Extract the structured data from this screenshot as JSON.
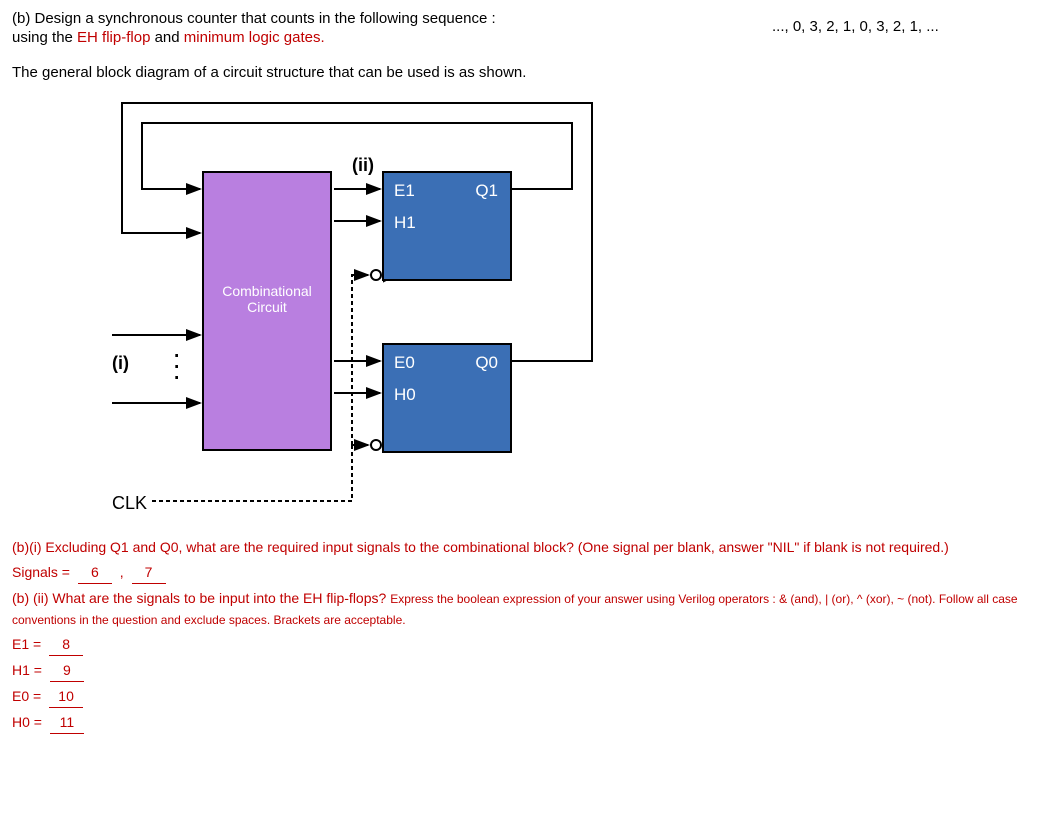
{
  "header": {
    "part": "(b)",
    "q_text_1": " Design a synchronous counter that counts in the following sequence :",
    "q_text_2": "using the ",
    "eh": "EH flip-flop",
    "and_": " and ",
    "min": "minimum logic gates.",
    "sequence": "..., 0, 3, 2, 1, 0, 3, 2, 1, ...",
    "intro": "The general block diagram of a circuit structure that can be used is as shown."
  },
  "diagram": {
    "combinational": "Combinational Circuit",
    "ii": "(ii)",
    "i": "(i)",
    "clk": "CLK",
    "ff1": {
      "E": "E1",
      "H": "H1",
      "Q": "Q1"
    },
    "ff0": {
      "E": "E0",
      "H": "H0",
      "Q": "Q0"
    }
  },
  "questions": {
    "bi": "(b)(i) Excluding Q1 and Q0, what are the required input signals to the combinational block? (One signal per blank, answer \"NIL\" if blank is not required.)",
    "signals_label": "Signals = ",
    "blank6": "6",
    "blank7": "7",
    "comma": ",",
    "bii_1": "(b) (ii) What are the signals to be input into the EH flip-flops? ",
    "bii_2": "Express the boolean expression of your answer using Verilog operators : & (and), | (or), ^ (xor), ~ (not). Follow all case conventions in the question and exclude spaces. Brackets are acceptable.",
    "e1_label": "E1 = ",
    "e1_blank": "8",
    "h1_label": "H1 = ",
    "h1_blank": "9",
    "e0_label": "E0 = ",
    "e0_blank": "10",
    "h0_label": "H0 = ",
    "h0_blank": "11"
  }
}
